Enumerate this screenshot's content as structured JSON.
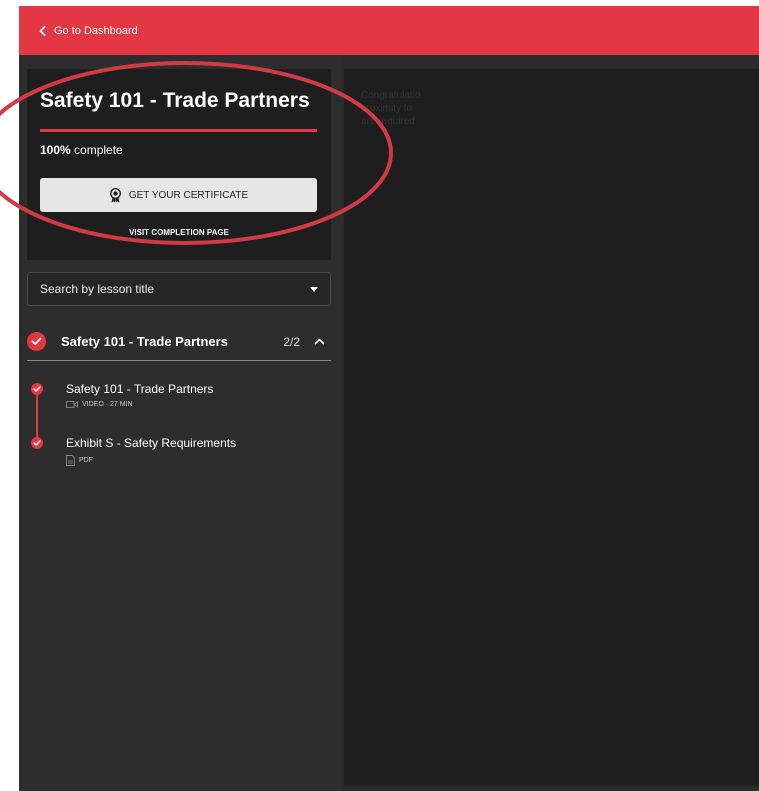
{
  "topbar": {
    "back_label": "Go to Dashboard"
  },
  "course": {
    "title": "Safety 101 - Trade Partners",
    "progress_percent": 100,
    "progress_value": "100%",
    "progress_suffix": " complete",
    "certificate_button": "GET YOUR CERTIFICATE",
    "completion_link": "VISIT COMPLETION PAGE"
  },
  "search": {
    "placeholder": "Search by lesson title"
  },
  "section": {
    "title": "Safety 101 - Trade Partners",
    "count": "2/2",
    "lessons": [
      {
        "title": "Safety 101 - Trade Partners",
        "meta": "VIDEO · 27 MIN",
        "icon": "video-icon"
      },
      {
        "title": "Exhibit S - Safety Requirements",
        "meta": "PDF",
        "icon": "pdf-icon"
      }
    ]
  },
  "main": {
    "text_lines": [
      "Congratulatio",
      "proximity to",
      "are required"
    ]
  },
  "colors": {
    "accent": "#e43744",
    "sidebar": "#2d2d2d",
    "card": "#1e1e1e",
    "annotation": "#d23a45"
  }
}
